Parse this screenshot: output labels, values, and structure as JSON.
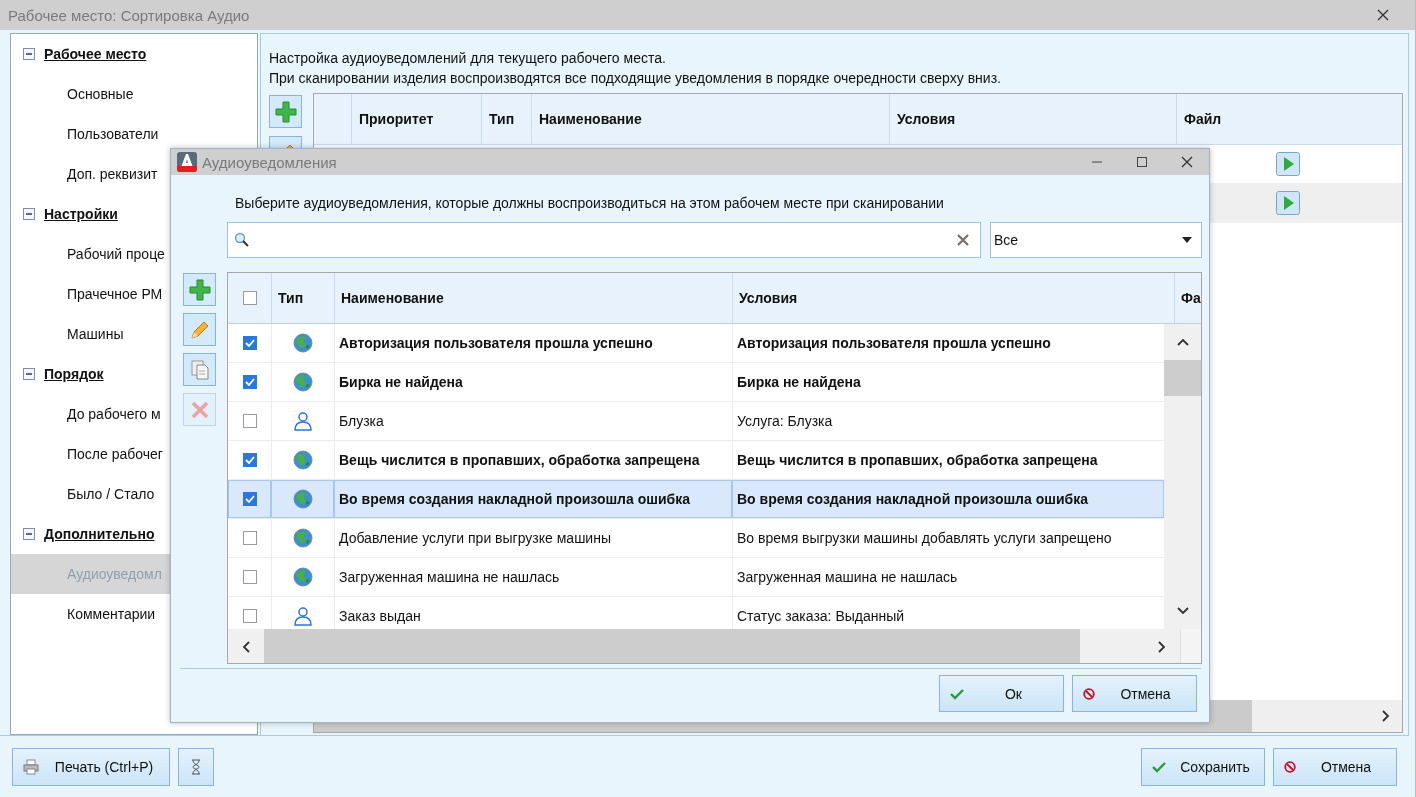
{
  "window": {
    "title": "Рабочее место: Сортировка Аудио"
  },
  "sidebar": {
    "groups": [
      {
        "label": "Рабочее место",
        "expanded": true,
        "children": [
          {
            "label": "Основные",
            "selected": false
          },
          {
            "label": "Пользователи",
            "selected": false
          },
          {
            "label": "Доп. реквизит",
            "selected": false
          }
        ]
      },
      {
        "label": "Настройки",
        "expanded": true,
        "children": [
          {
            "label": "Рабочий проце",
            "selected": false
          },
          {
            "label": "Прачечное РМ",
            "selected": false
          },
          {
            "label": "Машины",
            "selected": false
          }
        ]
      },
      {
        "label": "Порядок",
        "expanded": true,
        "children": [
          {
            "label": "До рабочего м",
            "selected": false
          },
          {
            "label": "После рабочег",
            "selected": false
          },
          {
            "label": "Было / Стало",
            "selected": false
          }
        ]
      },
      {
        "label": "Дополнительно",
        "expanded": true,
        "children": [
          {
            "label": "Аудиоуведомл",
            "selected": true
          },
          {
            "label": "Комментарии",
            "selected": false
          }
        ]
      }
    ]
  },
  "main": {
    "description": [
      "Настройка аудиоуведомлений для текущего рабочего места.",
      "При сканировании изделия воспроизводятся все подходящие уведомления в порядке очередности сверху вниз."
    ],
    "table": {
      "columns": [
        "Приоритет",
        "Тип",
        "Наименование",
        "Условия",
        "Файл"
      ],
      "rows": [
        {
          "selected": false
        },
        {
          "selected": true
        }
      ]
    }
  },
  "footer": {
    "print_button": "Печать (Ctrl+P)",
    "save_button": "Сохранить",
    "cancel_button": "Отмена"
  },
  "dialog": {
    "title": "Аудиоуведомления",
    "instruction": "Выберите аудиоуведомления, которые должны воспроизводиться на этом рабочем месте при сканировании",
    "filter": {
      "value": "Все"
    },
    "toolbar": [
      {
        "kind": "add",
        "disabled": false
      },
      {
        "kind": "edit",
        "disabled": false
      },
      {
        "kind": "copy",
        "disabled": false
      },
      {
        "kind": "delete",
        "disabled": true
      }
    ],
    "table": {
      "header_checked": false,
      "columns": [
        "Тип",
        "Наименование",
        "Условия",
        "Фа"
      ],
      "rows": [
        {
          "checked": true,
          "kind": "globe",
          "name": "Авторизация пользователя прошла успешно",
          "condition": "Авторизация пользователя прошла успешно",
          "selected": false
        },
        {
          "checked": true,
          "kind": "globe",
          "name": "Бирка не найдена",
          "condition": "Бирка не найдена",
          "selected": false
        },
        {
          "checked": false,
          "kind": "person",
          "name": "Блузка",
          "condition": "Услуга: Блузка",
          "selected": false
        },
        {
          "checked": true,
          "kind": "globe",
          "name": "Вещь числится в пропавших, обработка запрещена",
          "condition": "Вещь числится в пропавших, обработка запрещена",
          "selected": false
        },
        {
          "checked": true,
          "kind": "globe",
          "name": "Во время создания накладной произошла ошибка",
          "condition": "Во время создания накладной произошла ошибка",
          "selected": true
        },
        {
          "checked": false,
          "kind": "globe",
          "name": "Добавление услуги при выгрузке машины",
          "condition": "Во время выгрузки машины добавлять услуги запрещено",
          "selected": false
        },
        {
          "checked": false,
          "kind": "globe",
          "name": "Загруженная машина не нашлась",
          "condition": "Загруженная машина не нашлась",
          "selected": false
        },
        {
          "checked": false,
          "kind": "person",
          "name": "Заказ выдан",
          "condition": "Статус заказа: Выданный",
          "selected": false
        }
      ]
    },
    "ok_button": "Ок",
    "cancel_button": "Отмена"
  }
}
